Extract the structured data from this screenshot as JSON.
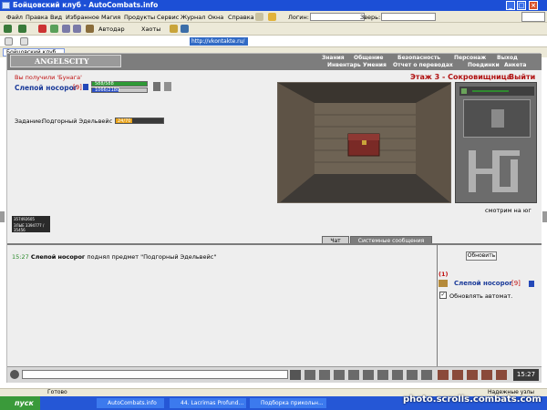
{
  "window": {
    "title": "Бойцовский клуб - AutoCombats.info",
    "min": "_",
    "max": "□",
    "close": "×"
  },
  "menu": [
    "Файл",
    "Правка",
    "Вид",
    "Избранное",
    "Магия",
    "Продукты",
    "Сервис",
    "Журнал",
    "Окна",
    "Справка"
  ],
  "toolbar": {
    "login_label": "Логин:",
    "pet_label": "Зверь:",
    "autodar": "Автодар",
    "haoty": "Хаоты"
  },
  "address": {
    "url": "http://vkontakte.ru/"
  },
  "tabs": [
    "Бойцовский клуб"
  ],
  "game": {
    "logo": "ANGELSCITY",
    "nav_top": [
      "Знания",
      "Общение",
      "Безопасность",
      "Персонаж",
      "Выход"
    ],
    "nav_bottom": [
      "Инвентарь",
      "Умения",
      "Отчет о переводах",
      "Поединки",
      "Анкета"
    ],
    "notice": "Вы получили 'Бунага'",
    "player": {
      "name": "Слепой носорог",
      "level": "[9]",
      "hp": "588/588",
      "mp": "1066/2180",
      "hp_frac": 1.0,
      "mp_frac": 0.49
    },
    "task": {
      "label": "Задание:",
      "name": "Подгорный Эдельвейс",
      "progress": "24/70"
    },
    "floor": "Этаж 3 - Сокровищница",
    "exit": "Выйти",
    "direction": "смотрим на юг",
    "counter1": "357492605",
    "counter2": "ЗЛЫЕ 3394777 / 35456",
    "chat_tabs": [
      "Чат",
      "Системные сообщения"
    ],
    "chat": [
      {
        "time": "15:27",
        "name": "Слепой носорог",
        "text": "поднял предмет \"Подгорный Эдельвейс\""
      }
    ],
    "refresh": "Обновить",
    "online_count": "(1)",
    "online_user": "Слепой носорог",
    "online_level": "[9]",
    "auto_refresh": "Обновлять автомат.",
    "clock": "15:27"
  },
  "status": {
    "text": "Готово",
    "zone": "Надежные узлы"
  },
  "taskbar": {
    "start": "пуск",
    "tasks": [
      "AutoCombats.info",
      "44. Lacrimas Profund...",
      "Подборка прикольн..."
    ]
  },
  "watermark": "photo.scrolls.combats.com"
}
